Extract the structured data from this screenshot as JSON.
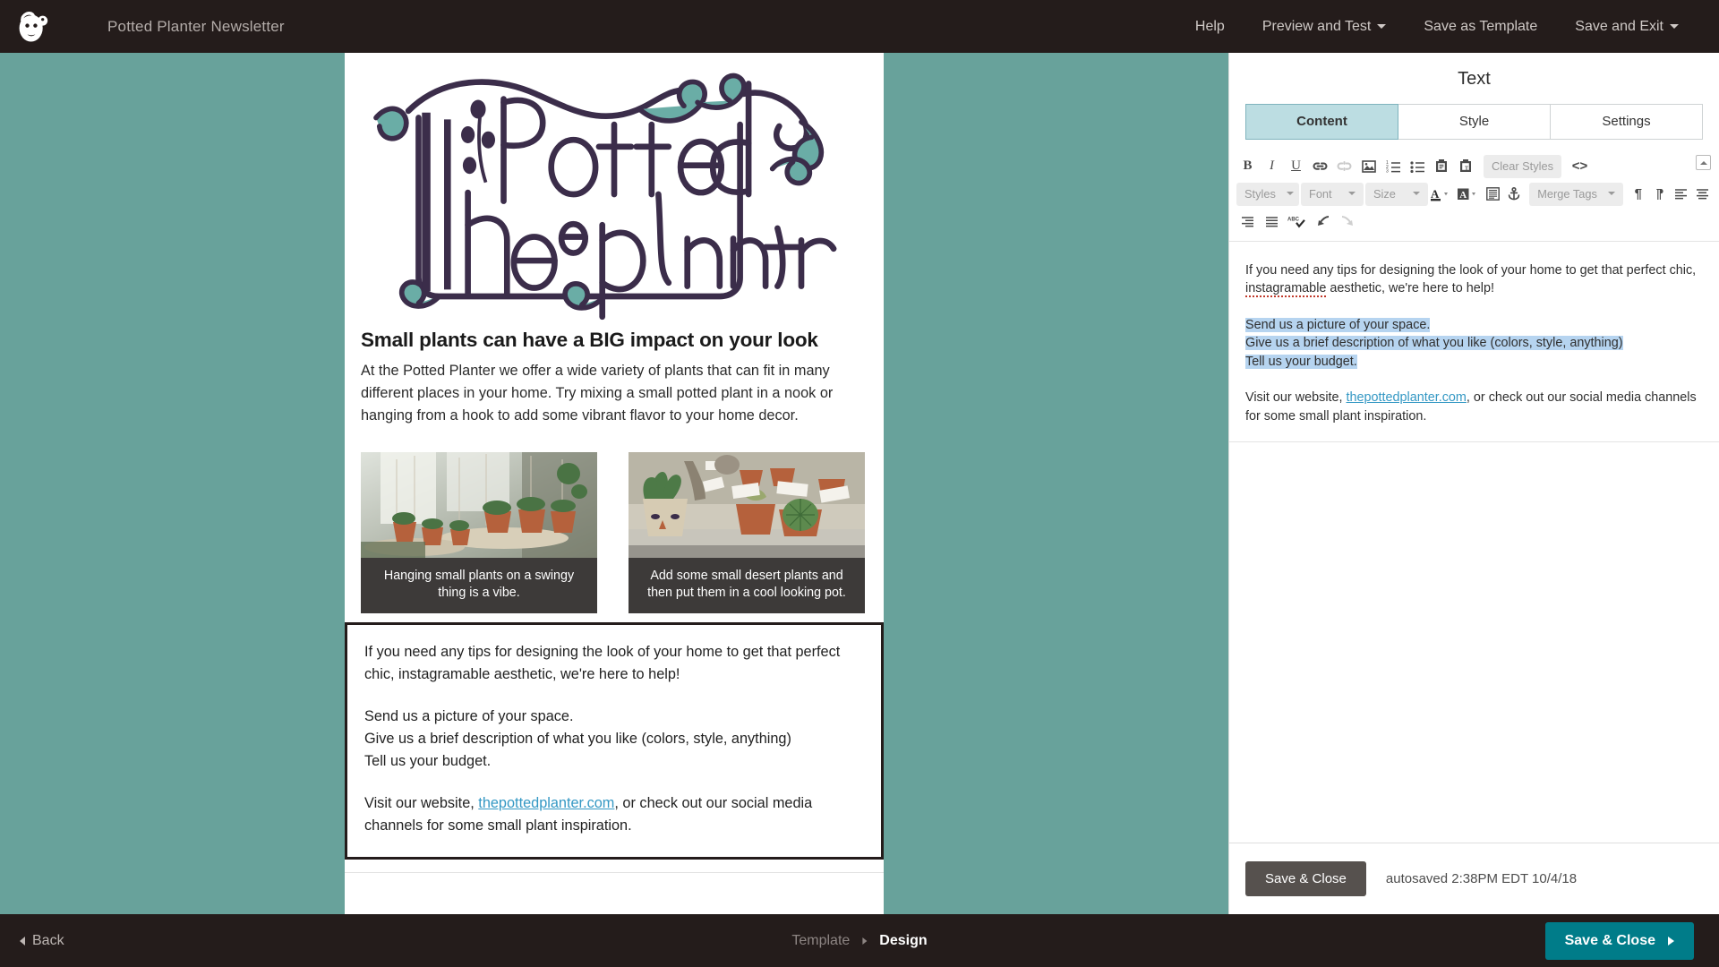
{
  "header": {
    "logo_icon": "mailchimp-freddie-icon",
    "campaign_title": "Potted Planter Newsletter",
    "nav": [
      {
        "label": "Help",
        "has_caret": false
      },
      {
        "label": "Preview and Test",
        "has_caret": true
      },
      {
        "label": "Save as Template",
        "has_caret": false
      },
      {
        "label": "Save and Exit",
        "has_caret": true
      }
    ]
  },
  "canvas": {
    "background_color": "#68a29b",
    "logo_alt": "The Potted Planter hand-lettered logo",
    "headline": "Small plants can have a BIG impact on your look",
    "intro_paragraph": "At the Potted Planter we offer a wide variety of plants that can fit in many different places in your home. Try mixing a small potted plant in a nook or hanging from a hook to add some vibrant flavor to your home decor.",
    "photos": [
      {
        "alt": "hanging-plants-photo",
        "caption": "Hanging small plants on a swingy thing is a vibe."
      },
      {
        "alt": "desert-plants-photo",
        "caption": "Add some small desert plants and then put them in a cool looking pot."
      }
    ],
    "text_block": {
      "para1": "If you need any tips for designing the look of your home to get that perfect chic, instagramable aesthetic, we're here to help!",
      "line1": "Send us a picture of your space.",
      "line2": "Give us a brief description of what you like (colors, style, anything)",
      "line3": "Tell us your budget.",
      "para3_before": "Visit our website, ",
      "para3_link": "thepottedplanter.com",
      "para3_after": ", or check out our social media channels for some small plant inspiration."
    }
  },
  "panel": {
    "title": "Text",
    "tabs": [
      {
        "label": "Content",
        "active": true
      },
      {
        "label": "Style",
        "active": false
      },
      {
        "label": "Settings",
        "active": false
      }
    ],
    "toolbar": {
      "row1": [
        {
          "name": "bold-icon",
          "glyph": "B"
        },
        {
          "name": "italic-icon",
          "glyph": "I"
        },
        {
          "name": "underline-icon",
          "glyph": "U"
        },
        {
          "name": "insert-link-icon",
          "glyph": "link"
        },
        {
          "name": "unlink-icon",
          "glyph": "unlink"
        },
        {
          "name": "insert-image-icon",
          "glyph": "image"
        },
        {
          "name": "numbered-list-icon",
          "glyph": "ol"
        },
        {
          "name": "bulleted-list-icon",
          "glyph": "ul"
        },
        {
          "name": "paste-icon",
          "glyph": "paste"
        },
        {
          "name": "paste-as-text-icon",
          "glyph": "paste-text"
        }
      ],
      "clear_styles_label": "Clear Styles",
      "source_code_icon": "source-code-icon",
      "collapse_icon": "collapse-toolbar-icon",
      "row2": {
        "styles_label": "Styles",
        "font_label": "Font",
        "size_label": "Size",
        "text_color_icon": "text-color-icon",
        "background-color_icon": "text-background-color-icon",
        "block_icon": "block-format-icon",
        "anchor_icon": "anchor-icon",
        "merge_tags_label": "Merge Tags",
        "paragraph_icon": "paragraph-mark-icon",
        "rtl_icon": "text-direction-icon",
        "align_left_icon": "align-left-icon",
        "align_center_icon": "align-center-icon"
      },
      "row3": [
        {
          "name": "align-right-icon"
        },
        {
          "name": "align-justify-icon"
        },
        {
          "name": "spell-check-icon"
        },
        {
          "name": "undo-icon"
        },
        {
          "name": "redo-icon"
        }
      ]
    },
    "editor": {
      "para1_a": "If you need any tips for designing the look of your home to get that perfect chic, ",
      "para1_spell": "instagramable",
      "para1_b": " aesthetic, we're here to help!",
      "sel1": "Send us a picture of your space.",
      "sel2": "Give us a brief description of what you like (colors, style, anything)",
      "sel3": "Tell us your budget.",
      "para3_before": "Visit our website, ",
      "para3_link": "thepottedplanter.com",
      "para3_after": ", or check out our social media channels for some small plant inspiration.",
      "selection_color": "#b6d4f0"
    },
    "footer": {
      "save_close_label": "Save & Close",
      "autosave_label": "autosaved 2:38PM EDT 10/4/18"
    }
  },
  "footer": {
    "back_label": "Back",
    "breadcrumb": [
      {
        "label": "Template",
        "active": false
      },
      {
        "label": "Design",
        "active": true
      }
    ],
    "save_close_label": "Save & Close",
    "accent_color": "#007c89"
  }
}
